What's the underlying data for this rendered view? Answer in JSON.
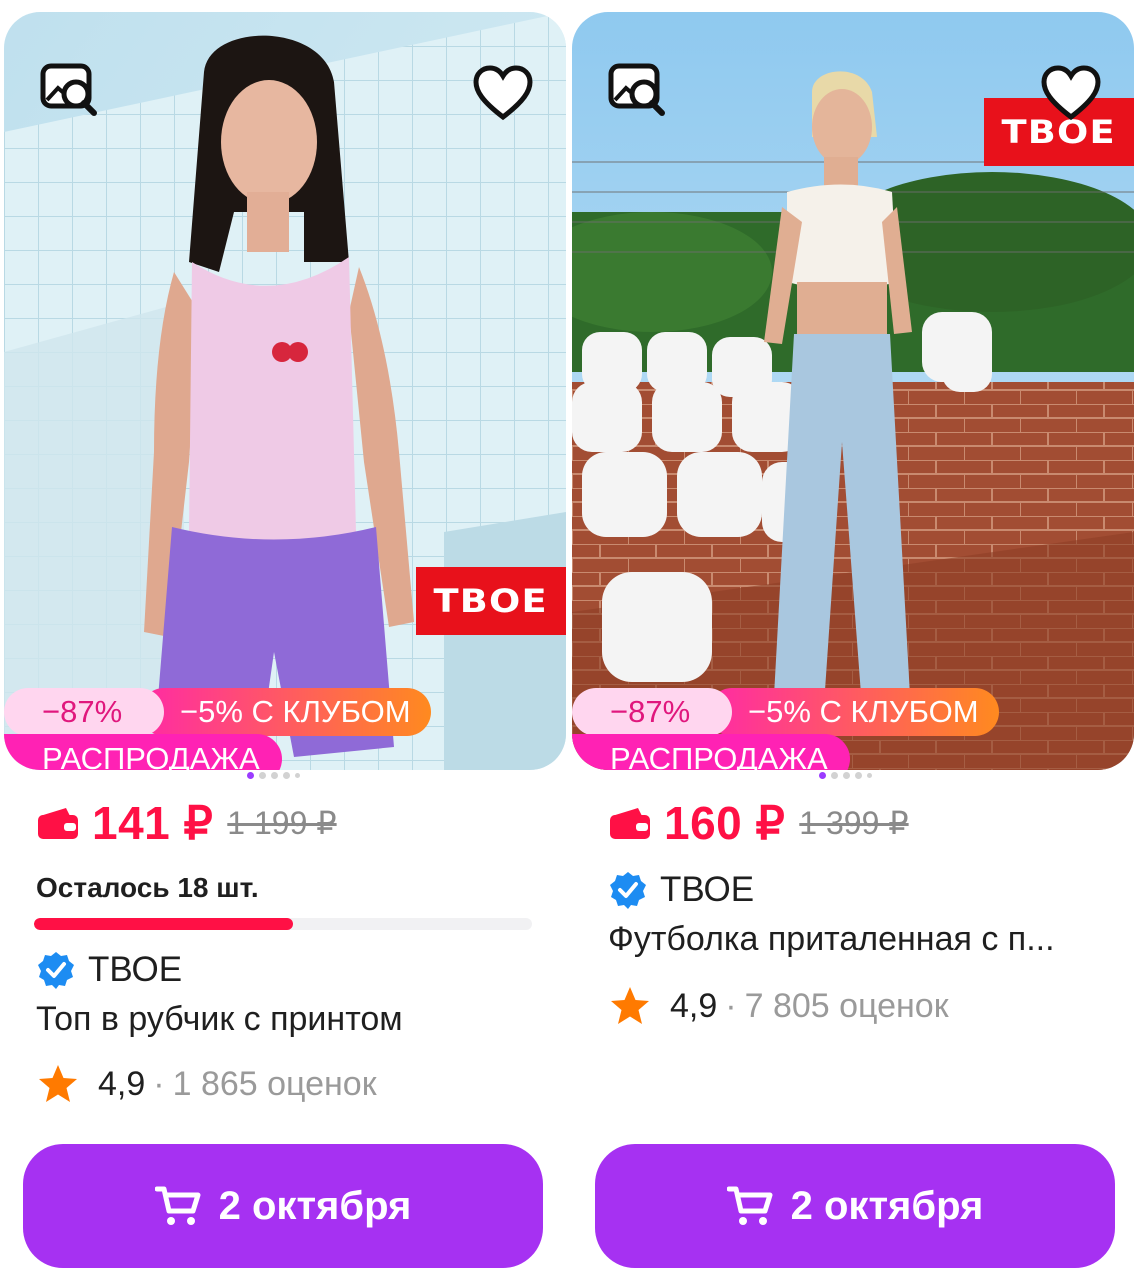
{
  "colors": {
    "price": "#ff1045",
    "cart_button": "#a631f2",
    "sale_badge": "#ff22b4",
    "discount_badge_bg": "#ffd6ef",
    "brand_red": "#e8111b",
    "verified_blue": "#1d8cf2",
    "star_orange": "#ff7a00"
  },
  "products": [
    {
      "brand_logo": "ТВОЕ",
      "badges": {
        "discount": "−87%",
        "club": "−5% С КЛУБОМ",
        "sale": "РАСПРОДАЖА"
      },
      "price": "141 ₽",
      "old_price": "1 199 ₽",
      "stock_text": "Осталось 18 шт.",
      "stock_fraction": 0.52,
      "seller": "ТВОЕ",
      "title": "Топ в рубчик с принтом",
      "rating": "4,9",
      "rating_sep": "·",
      "reviews": "1 865 оценок",
      "delivery_label": "2 октября",
      "icons": [
        "image-search-icon",
        "heart-icon",
        "wallet-icon",
        "verified-icon",
        "star-icon",
        "cart-icon"
      ]
    },
    {
      "brand_logo": "ТВОЕ",
      "badges": {
        "discount": "−87%",
        "club": "−5% С КЛУБОМ",
        "sale": "РАСПРОДАЖА"
      },
      "price": "160 ₽",
      "old_price": "1 399 ₽",
      "seller": "ТВОЕ",
      "title": "Футболка приталенная с п...",
      "rating": "4,9",
      "rating_sep": "·",
      "reviews": "7 805 оценок",
      "delivery_label": "2 октября",
      "icons": [
        "image-search-icon",
        "heart-icon",
        "wallet-icon",
        "verified-icon",
        "star-icon",
        "cart-icon"
      ]
    }
  ]
}
